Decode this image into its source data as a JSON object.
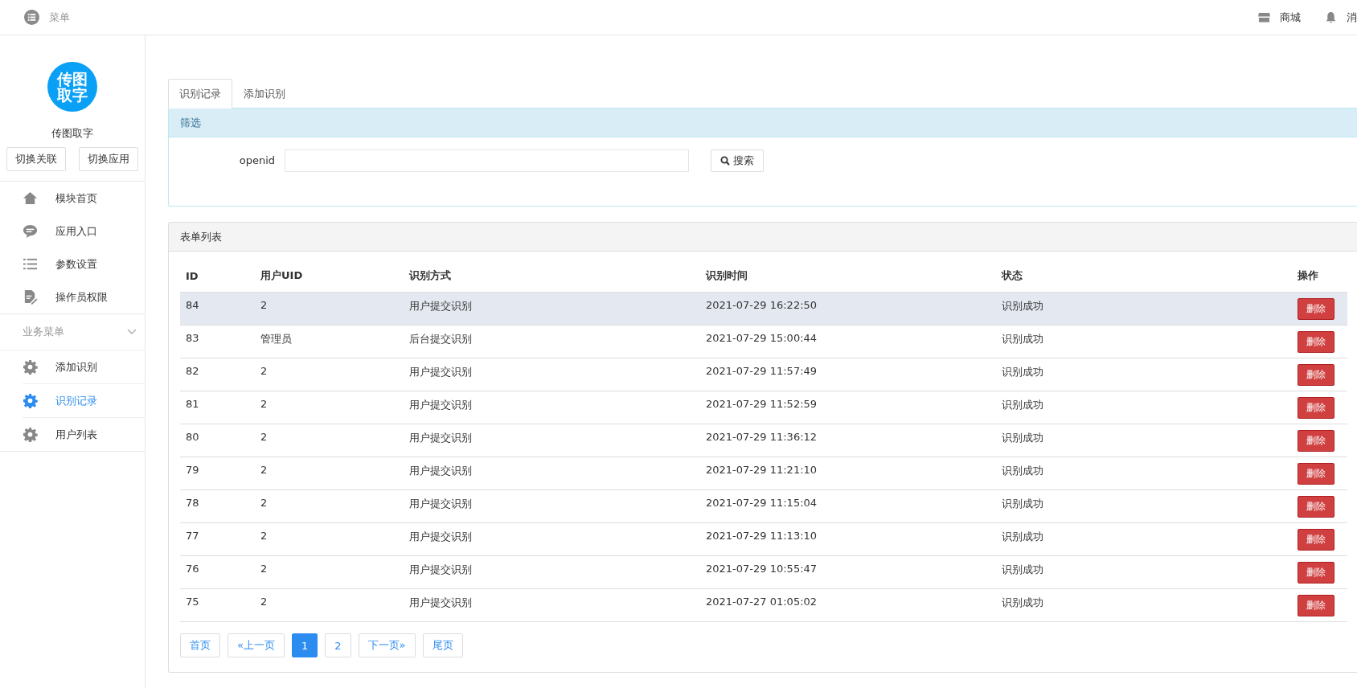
{
  "header": {
    "menu_label": "菜单",
    "links": [
      {
        "kind": "shop",
        "label": "商城"
      },
      {
        "kind": "bell",
        "label": "消"
      }
    ]
  },
  "sidebar": {
    "logo_text": [
      "传图",
      "取字"
    ],
    "app_name": "传图取字",
    "buttons": [
      "切换关联",
      "切换应用"
    ],
    "items": [
      {
        "kind": "home",
        "label": "模块首页",
        "selected": false
      },
      {
        "kind": "chat",
        "label": "应用入口",
        "selected": false
      },
      {
        "kind": "list",
        "label": "参数设置",
        "selected": false
      },
      {
        "kind": "doc",
        "label": "操作员权限",
        "selected": false
      }
    ],
    "group": {
      "label": "业务菜单",
      "expanded": true,
      "items": [
        {
          "kind": "gear",
          "label": "添加识别",
          "selected": false
        },
        {
          "kind": "gear",
          "label": "识别记录",
          "selected": true
        },
        {
          "kind": "gear",
          "label": "用户列表",
          "selected": false
        }
      ]
    }
  },
  "tabs": [
    {
      "label": "识别记录",
      "selected": true
    },
    {
      "label": "添加识别",
      "selected": false
    }
  ],
  "filter": {
    "title": "筛选",
    "field_label": "openid",
    "search_button": "搜索"
  },
  "table": {
    "title": "表单列表",
    "columns": [
      "ID",
      "用户UID",
      "识别方式",
      "识别时间",
      "状态",
      "操作"
    ],
    "rows": [
      {
        "cells": [
          "84",
          "2",
          "用户提交识别",
          "2021-07-29 16:22:50",
          "识别成功"
        ],
        "action": "删除",
        "highlighted": true
      },
      {
        "cells": [
          "83",
          "管理员",
          "后台提交识别",
          "2021-07-29 15:00:44",
          "识别成功"
        ],
        "action": "删除",
        "highlighted": false
      },
      {
        "cells": [
          "82",
          "2",
          "用户提交识别",
          "2021-07-29 11:57:49",
          "识别成功"
        ],
        "action": "删除",
        "highlighted": false
      },
      {
        "cells": [
          "81",
          "2",
          "用户提交识别",
          "2021-07-29 11:52:59",
          "识别成功"
        ],
        "action": "删除",
        "highlighted": false
      },
      {
        "cells": [
          "80",
          "2",
          "用户提交识别",
          "2021-07-29 11:36:12",
          "识别成功"
        ],
        "action": "删除",
        "highlighted": false
      },
      {
        "cells": [
          "79",
          "2",
          "用户提交识别",
          "2021-07-29 11:21:10",
          "识别成功"
        ],
        "action": "删除",
        "highlighted": false
      },
      {
        "cells": [
          "78",
          "2",
          "用户提交识别",
          "2021-07-29 11:15:04",
          "识别成功"
        ],
        "action": "删除",
        "highlighted": false
      },
      {
        "cells": [
          "77",
          "2",
          "用户提交识别",
          "2021-07-29 11:13:10",
          "识别成功"
        ],
        "action": "删除",
        "highlighted": false
      },
      {
        "cells": [
          "76",
          "2",
          "用户提交识别",
          "2021-07-29 10:55:47",
          "识别成功"
        ],
        "action": "删除",
        "highlighted": false
      },
      {
        "cells": [
          "75",
          "2",
          "用户提交识别",
          "2021-07-27 01:05:02",
          "识别成功"
        ],
        "action": "删除",
        "highlighted": false
      }
    ]
  },
  "pagination": [
    {
      "label": "首页",
      "selected": false
    },
    {
      "label": "«上一页",
      "selected": false
    },
    {
      "label": "1",
      "selected": true
    },
    {
      "label": "2",
      "selected": false
    },
    {
      "label": "下一页»",
      "selected": false
    },
    {
      "label": "尾页",
      "selected": false
    }
  ]
}
